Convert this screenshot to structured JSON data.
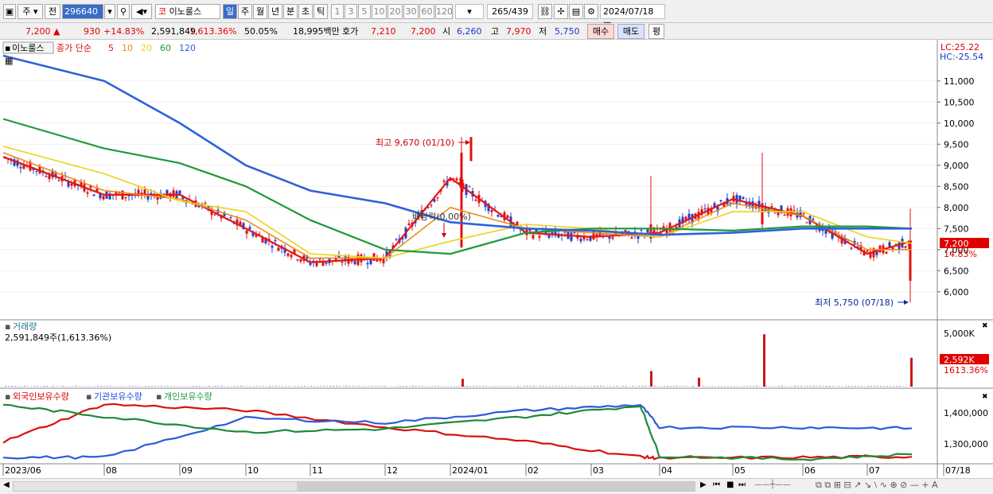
{
  "toolbar": {
    "period": "주",
    "type": "전",
    "code": "296640",
    "name": "이노룰스",
    "d": "일",
    "w": "주",
    "m": "월",
    "y": "년",
    "mi": "분",
    "s": "초",
    "t": "틱",
    "nums": [
      "1",
      "3",
      "5",
      "10",
      "20",
      "30",
      "60",
      "120"
    ],
    "count": "265",
    "total": "/439",
    "date": "2024/07/18"
  },
  "quote": {
    "price": "7,200",
    "arrow": "▲",
    "change": "930",
    "pct": "+14.83%",
    "volume": "2,591,849",
    "vol_pct": "1,613.36%",
    "ratio": "50.05%",
    "amount": "18,995백만",
    "hoga": "호가",
    "bid": "7,210",
    "ask": "7,200",
    "open_lbl": "시",
    "open": "6,260",
    "high_lbl": "고",
    "high": "7,970",
    "low_lbl": "저",
    "low": "5,750",
    "buy": "매수",
    "sell": "매도",
    "avg": "평"
  },
  "legend": {
    "name": "이노룰스",
    "title": "종가 단순",
    "mas": [
      {
        "p": "5",
        "c": "#e01818"
      },
      {
        "p": "10",
        "c": "#f08a1e"
      },
      {
        "p": "20",
        "c": "#ecd21a"
      },
      {
        "p": "60",
        "c": "#1e9a3a"
      },
      {
        "p": "120",
        "c": "#2e62d8"
      }
    ]
  },
  "price_axis": {
    "lc": "LC:25.22",
    "hc": "HC:-25.54",
    "ticks": [
      "11,000",
      "10,500",
      "10,000",
      "9,500",
      "9,000",
      "8,500",
      "8,000",
      "7,500",
      "7,000",
      "6,500",
      "6,000"
    ],
    "cur": "7,200",
    "cur_pct": "14.83%"
  },
  "ann": {
    "max": "최고 9,670 (01/10)",
    "min": "최저 5,750 (07/18)",
    "div": "배당락(0.00%)"
  },
  "vol": {
    "title": "거래량",
    "val": "2,591,849주(1,613.36%)",
    "ticks": [
      "5,000K"
    ],
    "cur": "2,592K",
    "cur_pct": "1613.36%"
  },
  "holdings": {
    "f": "외국인보유수량",
    "i": "기관보유수량",
    "p": "개인보유수량",
    "ticks": [
      "1,400,000",
      "1,300,000"
    ]
  },
  "xaxis": [
    "2023/06",
    "08",
    "09",
    "10",
    "11",
    "12",
    "2024/01",
    "02",
    "03",
    "04",
    "05",
    "06",
    "07",
    "07/18"
  ],
  "chart_data": [
    {
      "type": "line",
      "title": "종가 단순",
      "x": [
        "2023/06",
        "2023/08",
        "2023/09",
        "2023/10",
        "2023/11",
        "2023/12",
        "2024/01",
        "2024/02",
        "2024/03",
        "2024/04",
        "2024/05",
        "2024/06",
        "2024/07",
        "2024/07/18"
      ],
      "series": [
        {
          "name": "5",
          "values": [
            9200,
            8300,
            8300,
            7500,
            6700,
            6800,
            8700,
            7400,
            7300,
            7400,
            8200,
            7800,
            6900,
            7200
          ]
        },
        {
          "name": "10",
          "values": [
            9300,
            8400,
            8200,
            7700,
            6800,
            6800,
            8000,
            7500,
            7400,
            7300,
            8100,
            7800,
            7000,
            7000
          ]
        },
        {
          "name": "20",
          "values": [
            9450,
            8800,
            8150,
            7900,
            6900,
            6800,
            7200,
            7600,
            7500,
            7300,
            7900,
            7900,
            7300,
            7150
          ]
        },
        {
          "name": "60",
          "values": [
            10100,
            9400,
            9050,
            8500,
            7700,
            7000,
            6900,
            7400,
            7500,
            7500,
            7450,
            7550,
            7550,
            7500
          ]
        },
        {
          "name": "120",
          "values": [
            11600,
            11000,
            10000,
            9000,
            8400,
            8100,
            7650,
            7500,
            7450,
            7350,
            7400,
            7500,
            7500,
            7500
          ]
        }
      ],
      "ylim": [
        5750,
        11600
      ]
    },
    {
      "type": "bar",
      "title": "거래량",
      "x": [
        "2024/01/10",
        "2024/03/28",
        "2024/04/26",
        "2024/05/09",
        "2024/07/18"
      ],
      "values": [
        700,
        1400,
        800,
        4700,
        2592
      ],
      "ylabel": "K"
    },
    {
      "type": "line",
      "x": [
        "2023/06",
        "2023/08",
        "2023/10",
        "2023/12",
        "2024/02",
        "2024/03/26",
        "2024/04",
        "2024/06",
        "2024/07/18"
      ],
      "series": [
        {
          "name": "외국인보유수량",
          "values": [
            1318000,
            1440000,
            1420000,
            1365000,
            1320000,
            1270000,
            1265000,
            1268000,
            1270000
          ]
        },
        {
          "name": "기관보유수량",
          "values": [
            1268000,
            1268000,
            1395000,
            1380000,
            1420000,
            1438000,
            1365000,
            1365000,
            1362000
          ]
        },
        {
          "name": "개인보유수량",
          "values": [
            1438000,
            1400000,
            1350000,
            1360000,
            1400000,
            1435000,
            1272000,
            1262000,
            1278000
          ]
        }
      ]
    }
  ]
}
